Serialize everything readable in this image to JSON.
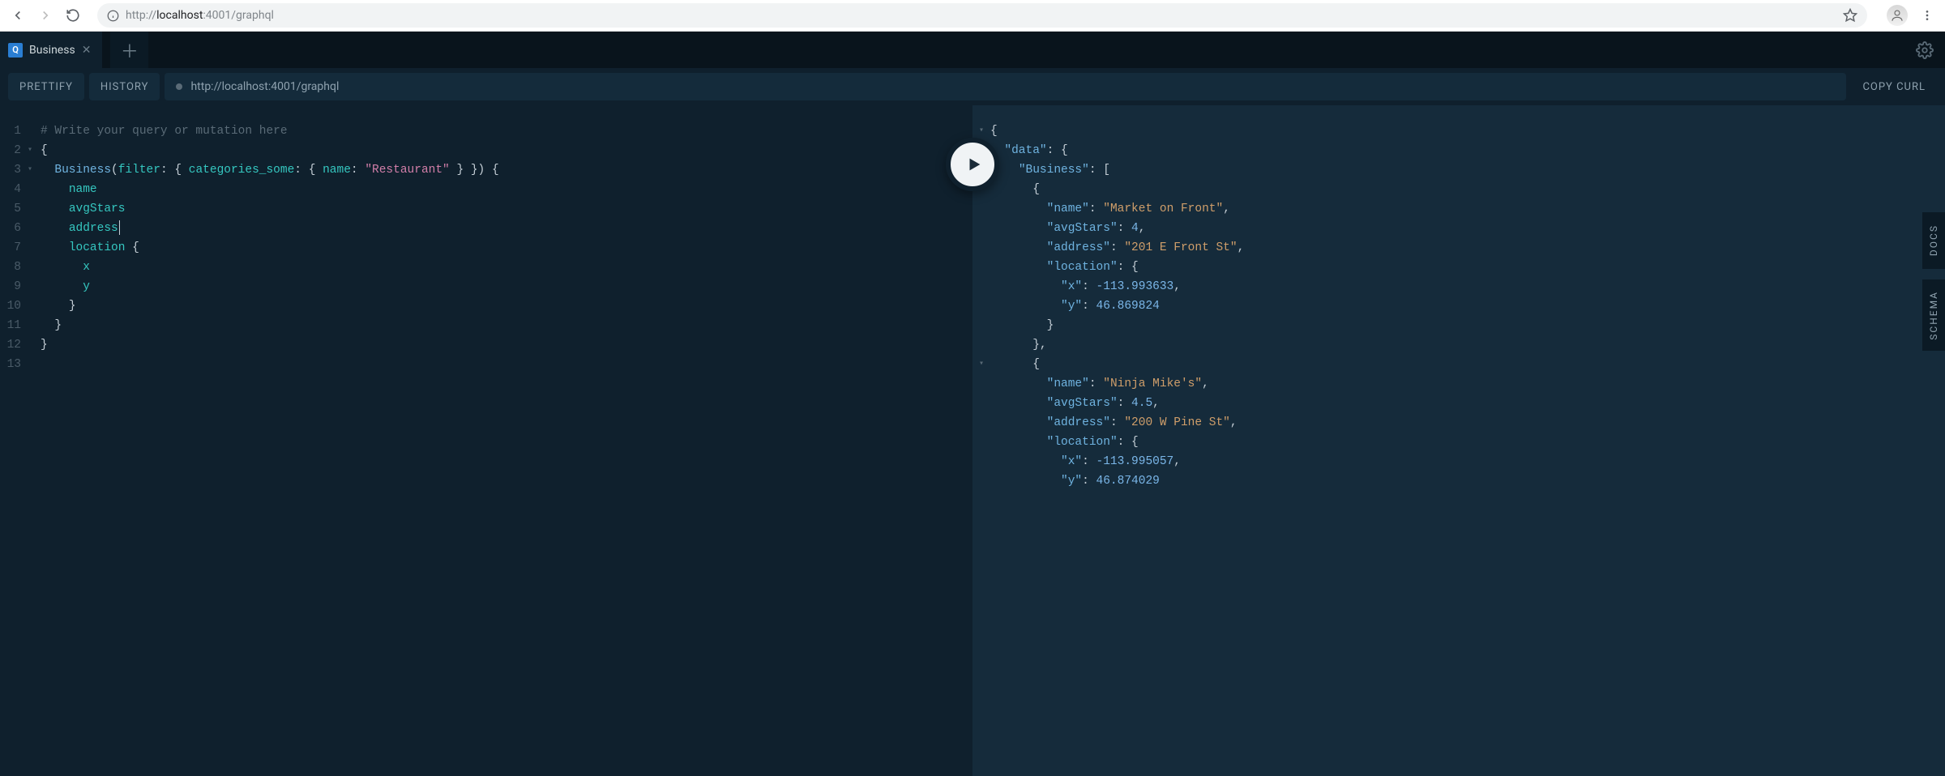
{
  "browser": {
    "url_protocol": "http://",
    "url_host": "localhost",
    "url_port_path": ":4001/graphql"
  },
  "tabs": {
    "active": {
      "badge": "Q",
      "label": "Business"
    }
  },
  "toolbar": {
    "prettify": "PRETTIFY",
    "history": "HISTORY",
    "endpoint": "http://localhost:4001/graphql",
    "copy_curl": "COPY CURL"
  },
  "rails": {
    "docs": "DOCS",
    "schema": "SCHEMA"
  },
  "editor": {
    "line_count": 13,
    "fold_markers": {
      "2": "▾",
      "3": "▾"
    },
    "comment": "# Write your query or mutation here",
    "query_tokens": {
      "business": "Business",
      "filter": "filter",
      "categories_some": "categories_some",
      "arg_name": "name",
      "arg_value": "\"Restaurant\"",
      "f_name": "name",
      "f_avgStars": "avgStars",
      "f_address": "address",
      "f_location": "location",
      "f_x": "x",
      "f_y": "y"
    }
  },
  "result": {
    "fold_lines": [
      1,
      2,
      3,
      4,
      15
    ],
    "data": {
      "Business": [
        {
          "name": "Market on Front",
          "avgStars": 4,
          "address": "201 E Front St",
          "location": {
            "x": -113.993633,
            "y": 46.869824
          }
        },
        {
          "name": "Ninja Mike's",
          "avgStars": 4.5,
          "address": "200 W Pine St",
          "location": {
            "x": -113.995057,
            "y": 46.874029
          }
        }
      ]
    }
  }
}
